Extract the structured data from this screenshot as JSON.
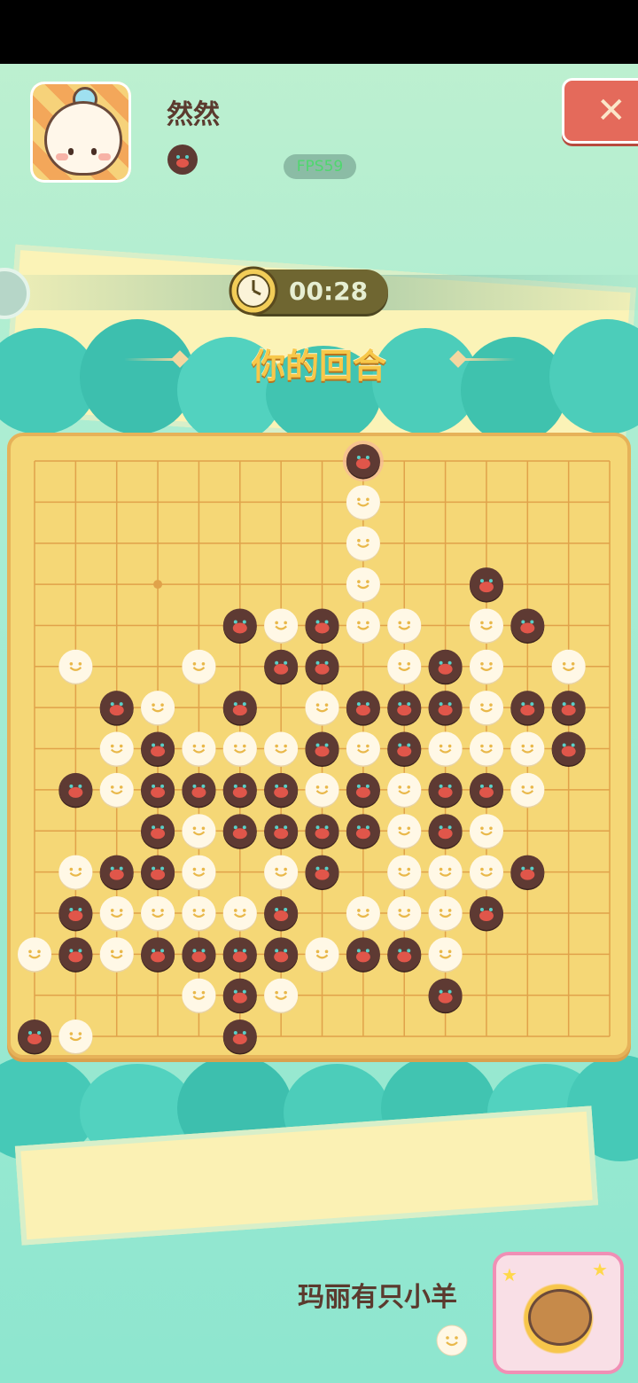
{
  "player": {
    "name": "然然",
    "stone": "black",
    "avatar": "girl-avatar-icon"
  },
  "fps": "FPS59",
  "close": {
    "icon": "close-x-icon"
  },
  "timer": {
    "time": "00:28",
    "icon": "clock-icon"
  },
  "turn": {
    "label": "你的回合"
  },
  "opponent": {
    "name": "玛丽有只小羊",
    "stone": "white",
    "avatar": "sheep-avatar-icon"
  },
  "board": {
    "size": 15,
    "star_point": [
      3,
      3
    ],
    "last_move": [
      8,
      0
    ],
    "stones": [
      {
        "c": 8,
        "r": 0,
        "s": "b"
      },
      {
        "c": 8,
        "r": 1,
        "s": "w"
      },
      {
        "c": 8,
        "r": 2,
        "s": "w"
      },
      {
        "c": 8,
        "r": 3,
        "s": "w"
      },
      {
        "c": 11,
        "r": 3,
        "s": "b"
      },
      {
        "c": 5,
        "r": 4,
        "s": "b"
      },
      {
        "c": 6,
        "r": 4,
        "s": "w"
      },
      {
        "c": 7,
        "r": 4,
        "s": "b"
      },
      {
        "c": 8,
        "r": 4,
        "s": "w"
      },
      {
        "c": 9,
        "r": 4,
        "s": "w"
      },
      {
        "c": 11,
        "r": 4,
        "s": "w"
      },
      {
        "c": 12,
        "r": 4,
        "s": "b"
      },
      {
        "c": 1,
        "r": 5,
        "s": "w"
      },
      {
        "c": 4,
        "r": 5,
        "s": "w"
      },
      {
        "c": 6,
        "r": 5,
        "s": "b"
      },
      {
        "c": 7,
        "r": 5,
        "s": "b"
      },
      {
        "c": 9,
        "r": 5,
        "s": "w"
      },
      {
        "c": 10,
        "r": 5,
        "s": "b"
      },
      {
        "c": 11,
        "r": 5,
        "s": "w"
      },
      {
        "c": 13,
        "r": 5,
        "s": "w"
      },
      {
        "c": 2,
        "r": 6,
        "s": "b"
      },
      {
        "c": 3,
        "r": 6,
        "s": "w"
      },
      {
        "c": 5,
        "r": 6,
        "s": "b"
      },
      {
        "c": 7,
        "r": 6,
        "s": "w"
      },
      {
        "c": 8,
        "r": 6,
        "s": "b"
      },
      {
        "c": 9,
        "r": 6,
        "s": "b"
      },
      {
        "c": 10,
        "r": 6,
        "s": "b"
      },
      {
        "c": 11,
        "r": 6,
        "s": "w"
      },
      {
        "c": 12,
        "r": 6,
        "s": "b"
      },
      {
        "c": 13,
        "r": 6,
        "s": "b"
      },
      {
        "c": 2,
        "r": 7,
        "s": "w"
      },
      {
        "c": 3,
        "r": 7,
        "s": "b"
      },
      {
        "c": 4,
        "r": 7,
        "s": "w"
      },
      {
        "c": 5,
        "r": 7,
        "s": "w"
      },
      {
        "c": 6,
        "r": 7,
        "s": "w"
      },
      {
        "c": 7,
        "r": 7,
        "s": "b"
      },
      {
        "c": 8,
        "r": 7,
        "s": "w"
      },
      {
        "c": 9,
        "r": 7,
        "s": "b"
      },
      {
        "c": 10,
        "r": 7,
        "s": "w"
      },
      {
        "c": 11,
        "r": 7,
        "s": "w"
      },
      {
        "c": 12,
        "r": 7,
        "s": "w"
      },
      {
        "c": 13,
        "r": 7,
        "s": "b"
      },
      {
        "c": 1,
        "r": 8,
        "s": "b"
      },
      {
        "c": 2,
        "r": 8,
        "s": "w"
      },
      {
        "c": 3,
        "r": 8,
        "s": "b"
      },
      {
        "c": 4,
        "r": 8,
        "s": "b"
      },
      {
        "c": 5,
        "r": 8,
        "s": "b"
      },
      {
        "c": 6,
        "r": 8,
        "s": "b"
      },
      {
        "c": 7,
        "r": 8,
        "s": "w"
      },
      {
        "c": 8,
        "r": 8,
        "s": "b"
      },
      {
        "c": 9,
        "r": 8,
        "s": "w"
      },
      {
        "c": 10,
        "r": 8,
        "s": "b"
      },
      {
        "c": 11,
        "r": 8,
        "s": "b"
      },
      {
        "c": 12,
        "r": 8,
        "s": "w"
      },
      {
        "c": 3,
        "r": 9,
        "s": "b"
      },
      {
        "c": 4,
        "r": 9,
        "s": "w"
      },
      {
        "c": 5,
        "r": 9,
        "s": "b"
      },
      {
        "c": 6,
        "r": 9,
        "s": "b"
      },
      {
        "c": 7,
        "r": 9,
        "s": "b"
      },
      {
        "c": 8,
        "r": 9,
        "s": "b"
      },
      {
        "c": 9,
        "r": 9,
        "s": "w"
      },
      {
        "c": 10,
        "r": 9,
        "s": "b"
      },
      {
        "c": 11,
        "r": 9,
        "s": "w"
      },
      {
        "c": 1,
        "r": 10,
        "s": "w"
      },
      {
        "c": 2,
        "r": 10,
        "s": "b"
      },
      {
        "c": 3,
        "r": 10,
        "s": "b"
      },
      {
        "c": 4,
        "r": 10,
        "s": "w"
      },
      {
        "c": 6,
        "r": 10,
        "s": "w"
      },
      {
        "c": 7,
        "r": 10,
        "s": "b"
      },
      {
        "c": 9,
        "r": 10,
        "s": "w"
      },
      {
        "c": 10,
        "r": 10,
        "s": "w"
      },
      {
        "c": 11,
        "r": 10,
        "s": "w"
      },
      {
        "c": 12,
        "r": 10,
        "s": "b"
      },
      {
        "c": 1,
        "r": 11,
        "s": "b"
      },
      {
        "c": 2,
        "r": 11,
        "s": "w"
      },
      {
        "c": 3,
        "r": 11,
        "s": "w"
      },
      {
        "c": 4,
        "r": 11,
        "s": "w"
      },
      {
        "c": 5,
        "r": 11,
        "s": "w"
      },
      {
        "c": 6,
        "r": 11,
        "s": "b"
      },
      {
        "c": 8,
        "r": 11,
        "s": "w"
      },
      {
        "c": 9,
        "r": 11,
        "s": "w"
      },
      {
        "c": 10,
        "r": 11,
        "s": "w"
      },
      {
        "c": 11,
        "r": 11,
        "s": "b"
      },
      {
        "c": 0,
        "r": 12,
        "s": "w"
      },
      {
        "c": 1,
        "r": 12,
        "s": "b"
      },
      {
        "c": 2,
        "r": 12,
        "s": "w"
      },
      {
        "c": 3,
        "r": 12,
        "s": "b"
      },
      {
        "c": 4,
        "r": 12,
        "s": "b"
      },
      {
        "c": 5,
        "r": 12,
        "s": "b"
      },
      {
        "c": 6,
        "r": 12,
        "s": "b"
      },
      {
        "c": 7,
        "r": 12,
        "s": "w"
      },
      {
        "c": 8,
        "r": 12,
        "s": "b"
      },
      {
        "c": 9,
        "r": 12,
        "s": "b"
      },
      {
        "c": 10,
        "r": 12,
        "s": "w"
      },
      {
        "c": 4,
        "r": 13,
        "s": "w"
      },
      {
        "c": 5,
        "r": 13,
        "s": "b"
      },
      {
        "c": 6,
        "r": 13,
        "s": "w"
      },
      {
        "c": 10,
        "r": 13,
        "s": "b"
      },
      {
        "c": 0,
        "r": 14,
        "s": "b"
      },
      {
        "c": 1,
        "r": 14,
        "s": "w"
      },
      {
        "c": 5,
        "r": 14,
        "s": "b"
      }
    ]
  },
  "colors": {
    "board": "#f5d776",
    "grid_line": "#e0a24a",
    "black_stone": "#5e3a33",
    "black_mouth": "#e0564a",
    "white_stone": "#fff8e6",
    "white_face": "#e9b84a",
    "turn_text": "#f7c84a"
  }
}
